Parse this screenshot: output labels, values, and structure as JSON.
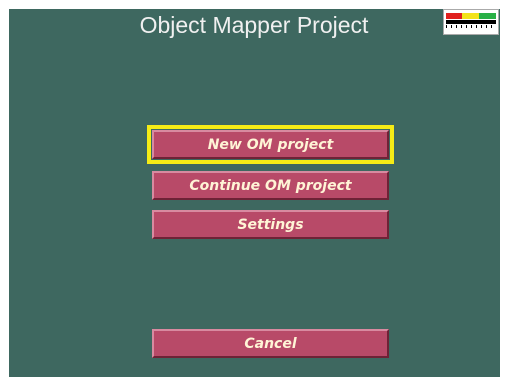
{
  "title": "Object Mapper Project",
  "buttons": {
    "new_project": "New OM project",
    "continue_project": "Continue OM project",
    "settings": "Settings",
    "cancel": "Cancel"
  },
  "colors": {
    "background": "#3e6860",
    "button": "#b84a68",
    "focus_highlight": "#f5ec16",
    "button_text": "#fff4d6"
  },
  "status_indicator": {
    "icon": "battery-level-icon",
    "segments": [
      "red",
      "yellow",
      "green"
    ]
  }
}
